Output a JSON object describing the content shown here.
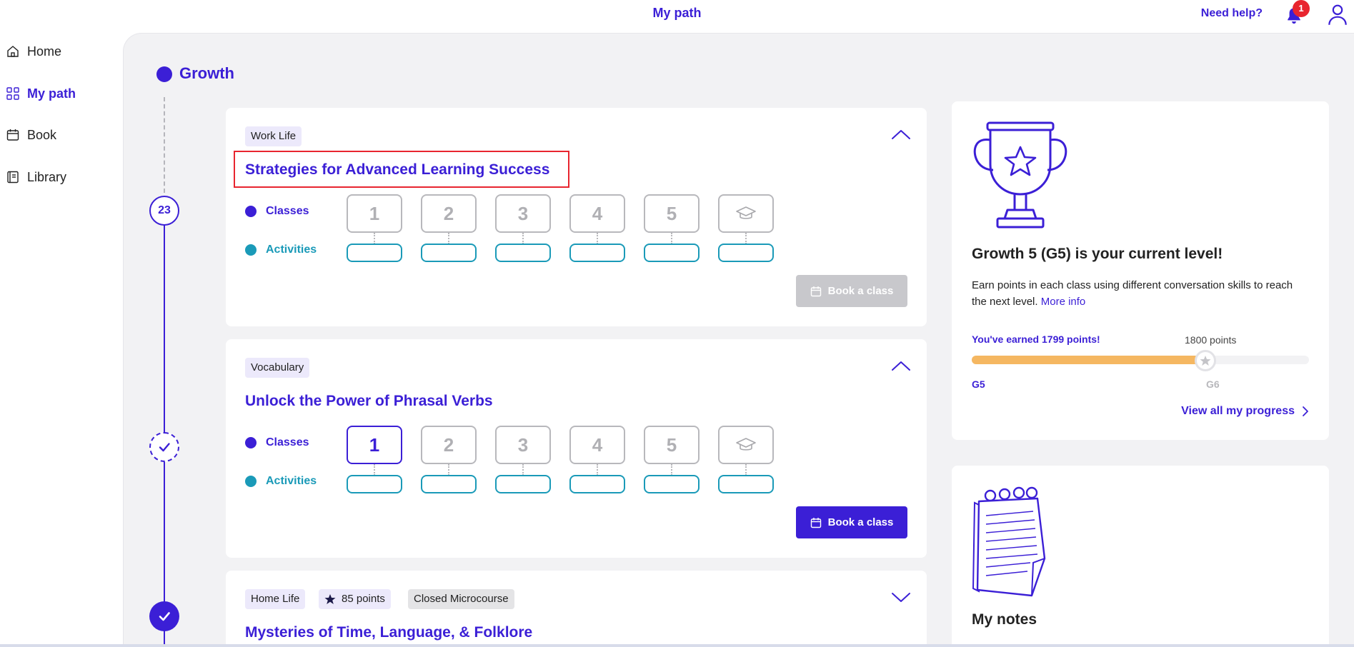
{
  "header": {
    "title": "My path",
    "need_help": "Need help?",
    "notification_count": "1"
  },
  "sidebar": {
    "items": [
      {
        "label": "Home",
        "icon": "home-icon",
        "active": false
      },
      {
        "label": "My path",
        "icon": "grid-icon",
        "active": true
      },
      {
        "label": "Book",
        "icon": "calendar-icon",
        "active": false
      },
      {
        "label": "Library",
        "icon": "book-icon",
        "active": false
      }
    ]
  },
  "path": {
    "stage": "Growth",
    "current_step": "23"
  },
  "courses": [
    {
      "tags": [
        "Work Life"
      ],
      "title": "Strategies for Advanced Learning Success",
      "classes_label": "Classes",
      "activities_label": "Activities",
      "class_numbers": [
        "1",
        "2",
        "3",
        "4",
        "5"
      ],
      "book_label": "Book a class",
      "book_enabled": false,
      "expanded": true
    },
    {
      "tags": [
        "Vocabulary"
      ],
      "title": "Unlock the Power of Phrasal Verbs",
      "classes_label": "Classes",
      "activities_label": "Activities",
      "class_numbers": [
        "1",
        "2",
        "3",
        "4",
        "5"
      ],
      "book_label": "Book a class",
      "book_enabled": true,
      "expanded": true
    },
    {
      "tags": [
        "Home Life",
        "85 points",
        "Closed Microcourse"
      ],
      "title": "Mysteries of Time, Language, & Folklore",
      "expanded": false
    }
  ],
  "level": {
    "title": "Growth 5 (G5) is your current level!",
    "description": "Earn points in each class using different conversation skills to reach the next level.",
    "more_info": "More info",
    "earned": "You've earned 1799 points!",
    "target": "1800 points",
    "progress_fraction": 0.7,
    "from_level": "G5",
    "to_level": "G6",
    "view_all": "View all my progress"
  },
  "notes": {
    "title": "My notes"
  },
  "colors": {
    "brand": "#3b1fd6",
    "activity": "#1a9ab8",
    "progress": "#f5b761",
    "alert": "#e8252f"
  }
}
